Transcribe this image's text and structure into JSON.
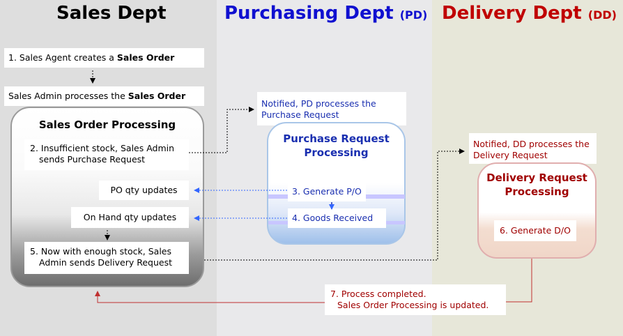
{
  "columns": {
    "sales": {
      "title": "Sales Dept"
    },
    "purchasing": {
      "title": "Purchasing Dept",
      "abbr": "(PD)"
    },
    "delivery": {
      "title": "Delivery Dept",
      "abbr": "(DD)"
    }
  },
  "sales": {
    "step1_prefix": "1. Sales Agent creates a ",
    "step1_bold": "Sales Order",
    "admin_prefix": "Sales Admin processes the ",
    "admin_bold": "Sales Order",
    "panel_title": "Sales Order Processing",
    "step2_line1": "2. Insufficient stock, Sales Admin",
    "step2_line2": "sends Purchase Request",
    "po_qty": "PO qty updates",
    "onhand_qty": "On Hand qty updates",
    "step5_line1": "5. Now with enough stock, Sales",
    "step5_line2": "Admin sends Delivery Request"
  },
  "purchasing": {
    "notified_line1": "Notified, PD processes the",
    "notified_line2": "Purchase Request",
    "panel_title_line1": "Purchase Request",
    "panel_title_line2": "Processing",
    "step3": "3. Generate P/O",
    "step4": "4. Goods Received"
  },
  "delivery": {
    "notified_line1": "Notified, DD processes the",
    "notified_line2": "Delivery Request",
    "panel_title_line1": "Delivery Request",
    "panel_title_line2": "Processing",
    "step6": "6. Generate D/O"
  },
  "completion": {
    "line1": "7. Process completed.",
    "line2": "Sales Order Processing is updated."
  },
  "colors": {
    "sales_title": "#000000",
    "purchasing_title": "#1010d0",
    "delivery_title": "#c00000",
    "pd_text": "#1a2fb0",
    "dd_text": "#a00000",
    "pd_arrow": "#3366ff",
    "dd_arrow": "#c03030"
  }
}
